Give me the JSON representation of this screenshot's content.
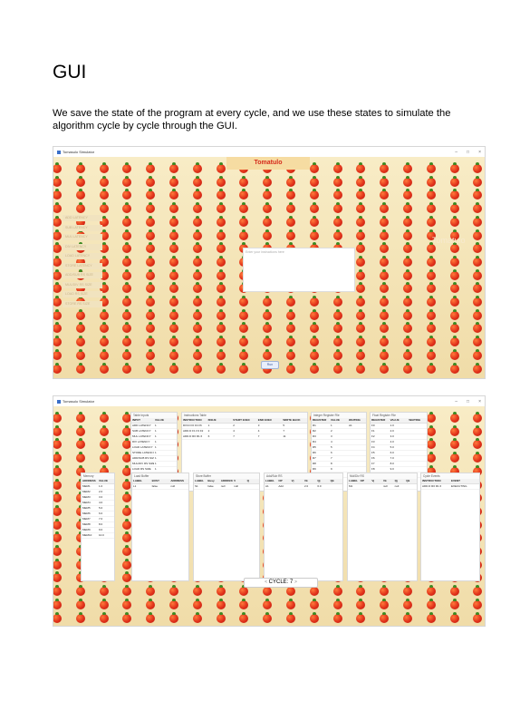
{
  "doc": {
    "heading": "GUI",
    "paragraph": "We save the state of the program at every cycle, and we use these states to simulate the algorithm cycle by cycle through the GUI."
  },
  "window1": {
    "title": "Tomasulo Simulator",
    "logo": "Tomatulo",
    "latency_labels": [
      "ADD LATENCY",
      "SUB LATENCY",
      "MUL LATENCY",
      "DIV LATENCY",
      "LOAD LATENCY",
      "STORE LATENCY",
      "ADD/SUB RS SIZE",
      "MUL/DIV RS SIZE",
      "LOAD RS SIZE",
      "STORE RS SIZE"
    ],
    "instruction_placeholder": "Enter your instructions here",
    "run_label": "Run",
    "ghost_text": "Tomatulo"
  },
  "window2": {
    "title": "Tomasulo Simulator",
    "table_inputs": {
      "title": "Table Inputs",
      "headers": [
        "INPUT",
        "VALUE"
      ],
      "rows": [
        [
          "ADD LATENCY",
          "1"
        ],
        [
          "SUB LATENCY",
          "1"
        ],
        [
          "MUL LATENCY",
          "1"
        ],
        [
          "DIV LATENCY",
          "1"
        ],
        [
          "LOAD LATENCY",
          "1"
        ],
        [
          "STORE LATENCY",
          "1"
        ],
        [
          "ADD/SUB RS SIZE",
          "1"
        ],
        [
          "MUL/DIV RS SIZE",
          "1"
        ],
        [
          "LOAD RS SIZE",
          "1"
        ],
        [
          "STORE RS SIZE",
          "1"
        ]
      ]
    },
    "instruction_table": {
      "title": "Instructions Table",
      "headers": [
        "INSTRUCTION",
        "ISSUE",
        "START EXEC",
        "END EXEC",
        "WRITE BACK"
      ],
      "rows": [
        [
          "DIV.D F0 F4 F6",
          "1",
          "2",
          "3",
          "5"
        ],
        [
          "ADD.D F1 F3 F2",
          "2",
          "4",
          "4",
          "7"
        ],
        [
          "ADD.D R0 R1 6",
          "6",
          "7",
          "7",
          "11"
        ]
      ]
    },
    "integer_regs": {
      "title": "Integer Register File",
      "headers": [
        "REGISTER",
        "VALUE",
        "WAITING"
      ],
      "rows": [
        [
          "R1",
          "1",
          "A1"
        ],
        [
          "R2",
          "2",
          ""
        ],
        [
          "R3",
          "3",
          ""
        ],
        [
          "R4",
          "4",
          ""
        ],
        [
          "R5",
          "5",
          ""
        ],
        [
          "R6",
          "6",
          ""
        ],
        [
          "R7",
          "7",
          ""
        ],
        [
          "R8",
          "8",
          ""
        ],
        [
          "R9",
          "9",
          ""
        ],
        [
          "R10",
          "10",
          ""
        ]
      ]
    },
    "float_regs": {
      "title": "Float Register File",
      "headers": [
        "REGISTER",
        "VALUE",
        "WAITING"
      ],
      "rows": [
        [
          "F0",
          "1.0",
          ""
        ],
        [
          "F1",
          "2.0",
          ""
        ],
        [
          "F2",
          "3.0",
          ""
        ],
        [
          "F3",
          "4.0",
          ""
        ],
        [
          "F4",
          "5.0",
          ""
        ],
        [
          "F5",
          "6.0",
          ""
        ],
        [
          "F6",
          "7.0",
          ""
        ],
        [
          "F7",
          "8.0",
          ""
        ],
        [
          "F8",
          "9.0",
          ""
        ],
        [
          "F9",
          "10.0",
          ""
        ]
      ]
    },
    "memory": {
      "title": "Memory",
      "headers": [
        "ADDRESS",
        "VALUE"
      ],
      "rows": [
        [
          "MEM1",
          "1.0"
        ],
        [
          "MEM2",
          "2.0"
        ],
        [
          "MEM3",
          "3.0"
        ],
        [
          "MEM4",
          "4.0"
        ],
        [
          "MEM5",
          "5.0"
        ],
        [
          "MEM6",
          "6.0"
        ],
        [
          "MEM7",
          "7.0"
        ],
        [
          "MEM8",
          "8.0"
        ],
        [
          "MEM9",
          "9.0"
        ],
        [
          "MEM10",
          "10.0"
        ]
      ]
    },
    "load_buffer": {
      "title": "Load Buffer",
      "headers": [
        "LABEL",
        "BUSY",
        "ADDRESS"
      ],
      "rows": [
        [
          "L1",
          "false",
          "null"
        ]
      ]
    },
    "store_buffer": {
      "title": "Store Buffer",
      "headers": [
        "LABEL",
        "Busy",
        "ADDRESS",
        "V",
        "Q"
      ],
      "rows": [
        [
          "S1",
          "false",
          "null",
          "null",
          ""
        ]
      ]
    },
    "add_sub_rs": {
      "title": "Add/Sub RS",
      "headers": [
        "LABEL",
        "OP",
        "Vj",
        "Vk",
        "Qj",
        "Qk"
      ],
      "rows": [
        [
          "A1",
          "Add",
          "",
          "2.0",
          "6.0",
          ""
        ]
      ]
    },
    "mul_div_rs": {
      "title": "Mul/Div RS",
      "headers": [
        "LABEL",
        "OP",
        "Vj",
        "Vk",
        "Qj",
        "Qk"
      ],
      "rows": [
        [
          "M1",
          "",
          "",
          "null",
          "null",
          ""
        ]
      ]
    },
    "cycle_events": {
      "title": "Cycle Events",
      "headers": [
        "INSTRUCTION",
        "EVENT"
      ],
      "rows": [
        [
          "ADD.D R0 R1 6",
          "EXECUTING"
        ]
      ]
    },
    "cycle_label": "CYCLE: 7",
    "prev_arrow": "<",
    "next_arrow": ">"
  }
}
